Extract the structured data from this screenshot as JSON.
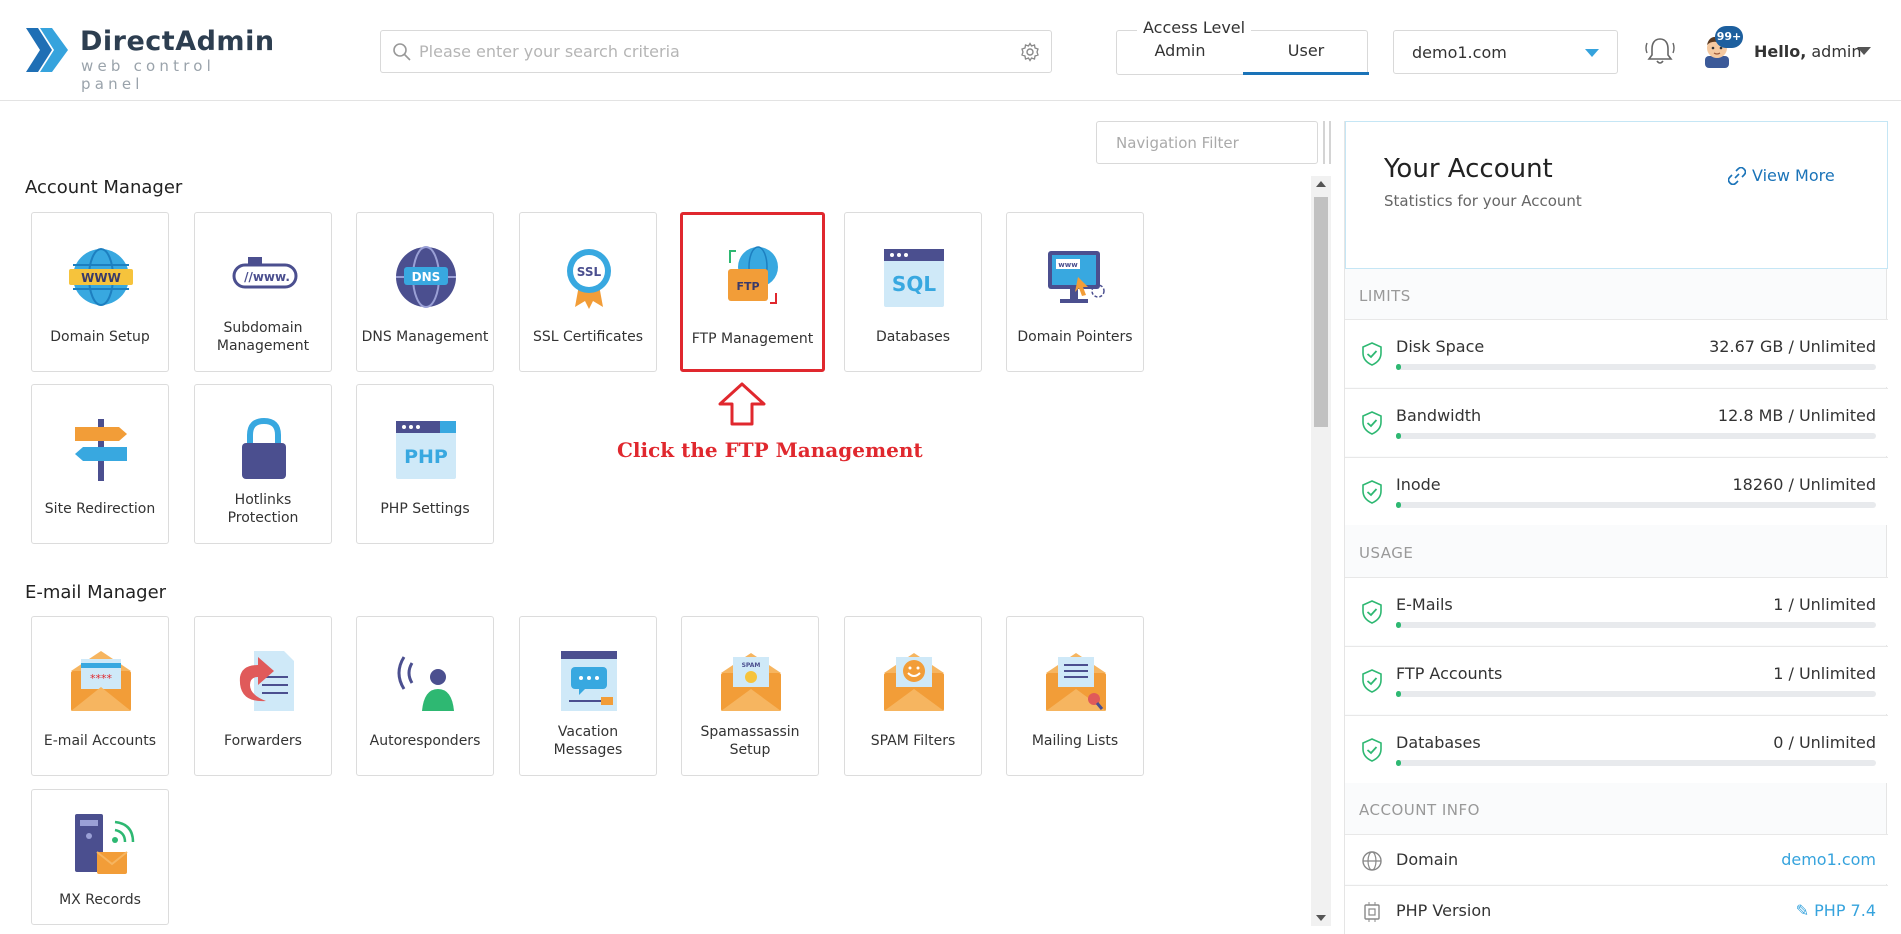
{
  "header": {
    "logo_name": "DirectAdmin",
    "logo_sub": "web control panel",
    "search_placeholder": "Please enter your search criteria",
    "access_level": {
      "label": "Access Level",
      "tabs": [
        "Admin",
        "User"
      ],
      "active": "User"
    },
    "domain_select": "demo1.com",
    "notification_badge": "99+",
    "hello_prefix": "Hello,",
    "hello_user": "admin"
  },
  "nav_filter_placeholder": "Navigation Filter",
  "account_manager": {
    "title": "Account Manager",
    "items": [
      {
        "label": "Domain Setup",
        "icon": "globe-www-icon"
      },
      {
        "label": "Subdomain Management",
        "icon": "subdomain-icon"
      },
      {
        "label": "DNS Management",
        "icon": "dns-icon"
      },
      {
        "label": "SSL Certificates",
        "icon": "ssl-badge-icon"
      },
      {
        "label": "FTP Management",
        "icon": "ftp-folder-icon"
      },
      {
        "label": "Databases",
        "icon": "sql-database-icon"
      },
      {
        "label": "Domain Pointers",
        "icon": "domain-pointer-icon"
      },
      {
        "label": "Site Redirection",
        "icon": "signpost-icon"
      },
      {
        "label": "Hotlinks Protection",
        "icon": "padlock-icon"
      },
      {
        "label": "PHP Settings",
        "icon": "php-window-icon"
      }
    ]
  },
  "email_manager": {
    "title": "E-mail Manager",
    "items": [
      {
        "label": "E-mail Accounts",
        "icon": "envelope-password-icon"
      },
      {
        "label": "Forwarders",
        "icon": "forward-document-icon"
      },
      {
        "label": "Autoresponders",
        "icon": "autoresponder-person-icon"
      },
      {
        "label": "Vacation Messages",
        "icon": "vacation-message-icon"
      },
      {
        "label": "Spamassassin Setup",
        "icon": "spam-envelope-icon"
      },
      {
        "label": "SPAM Filters",
        "icon": "smiley-envelope-icon"
      },
      {
        "label": "Mailing Lists",
        "icon": "mailing-list-envelope-icon"
      },
      {
        "label": "MX Records",
        "icon": "mx-server-icon"
      }
    ]
  },
  "annotation": {
    "text": "Click the FTP Management",
    "color": "#e0282e"
  },
  "panel": {
    "title": "Your Account",
    "subtitle": "Statistics for your Account",
    "view_more": "View More",
    "limits_title": "LIMITS",
    "limits": [
      {
        "name": "Disk Space",
        "value": "32.67 GB / Unlimited",
        "usage": 0.01
      },
      {
        "name": "Bandwidth",
        "value": "12.8 MB / Unlimited",
        "usage": 0.01
      },
      {
        "name": "Inode",
        "value": "18260 / Unlimited",
        "usage": 0.01
      }
    ],
    "usage_title": "USAGE",
    "usage": [
      {
        "name": "E-Mails",
        "value": "1 / Unlimited",
        "usage": 0.01
      },
      {
        "name": "FTP Accounts",
        "value": "1 / Unlimited",
        "usage": 0.01
      },
      {
        "name": "Databases",
        "value": "0 / Unlimited",
        "usage": 0.01
      }
    ],
    "account_info_title": "ACCOUNT INFO",
    "account_info": [
      {
        "name": "Domain",
        "value": "demo1.com",
        "icon": "globe-outline-icon"
      },
      {
        "name": "PHP Version",
        "value": "PHP 7.4",
        "icon": "chip-icon"
      }
    ]
  },
  "colors": {
    "accent": "#1a73b8",
    "link": "#36a3dd",
    "success": "#2eb872",
    "highlight": "#e0282e"
  }
}
